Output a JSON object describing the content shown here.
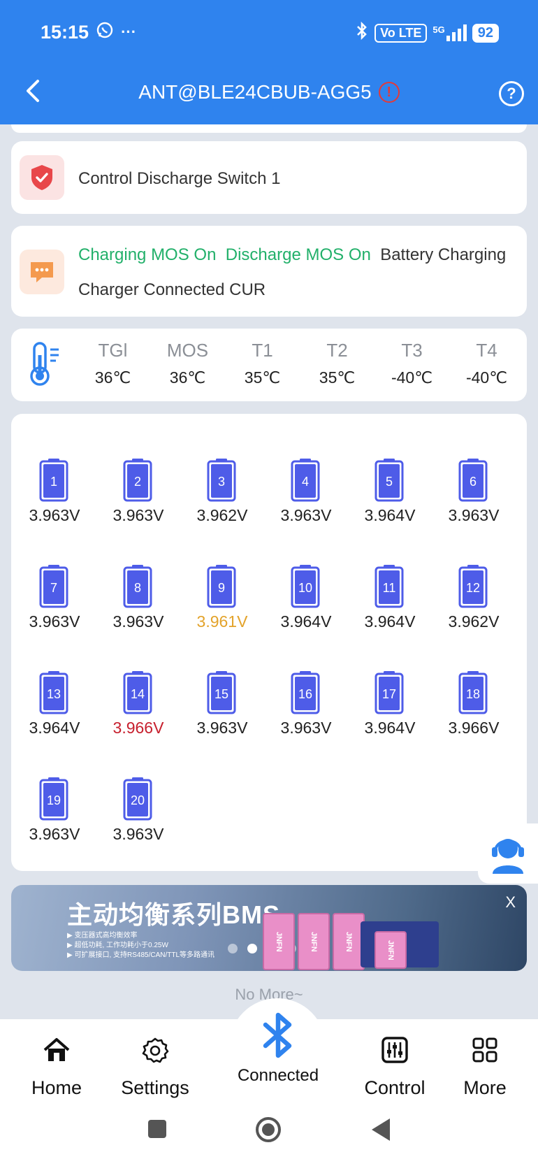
{
  "status_bar": {
    "time": "15:15",
    "volte": "Vo LTE",
    "network": "5G",
    "battery": "92"
  },
  "header": {
    "title": "ANT@BLE24CBUB-AGG5"
  },
  "control_card": {
    "label": "Control Discharge Switch 1"
  },
  "status_card": {
    "charging_mos": "Charging MOS On",
    "discharge_mos": "Discharge MOS On",
    "battery_state": "Battery Charging",
    "line2": "Charger Connected CUR"
  },
  "temps": [
    {
      "name": "TGl",
      "value": "36℃"
    },
    {
      "name": "MOS",
      "value": "36℃"
    },
    {
      "name": "T1",
      "value": "35℃"
    },
    {
      "name": "T2",
      "value": "35℃"
    },
    {
      "name": "T3",
      "value": "-40℃"
    },
    {
      "name": "T4",
      "value": "-40℃"
    }
  ],
  "cells": [
    {
      "n": "1",
      "v": "3.963V"
    },
    {
      "n": "2",
      "v": "3.963V"
    },
    {
      "n": "3",
      "v": "3.962V"
    },
    {
      "n": "4",
      "v": "3.963V"
    },
    {
      "n": "5",
      "v": "3.964V"
    },
    {
      "n": "6",
      "v": "3.963V"
    },
    {
      "n": "7",
      "v": "3.963V"
    },
    {
      "n": "8",
      "v": "3.963V"
    },
    {
      "n": "9",
      "v": "3.961V",
      "state": "min"
    },
    {
      "n": "10",
      "v": "3.964V"
    },
    {
      "n": "11",
      "v": "3.964V"
    },
    {
      "n": "12",
      "v": "3.962V"
    },
    {
      "n": "13",
      "v": "3.964V"
    },
    {
      "n": "14",
      "v": "3.966V",
      "state": "max"
    },
    {
      "n": "15",
      "v": "3.963V"
    },
    {
      "n": "16",
      "v": "3.963V"
    },
    {
      "n": "17",
      "v": "3.964V"
    },
    {
      "n": "18",
      "v": "3.966V"
    },
    {
      "n": "19",
      "v": "3.963V"
    },
    {
      "n": "20",
      "v": "3.963V"
    }
  ],
  "colors": {
    "primary": "#2f83ee",
    "cell": "#4e5ce8",
    "min": "#e3a32b",
    "max": "#c7202e",
    "ok": "#22b06a"
  },
  "banner": {
    "title": "主动均衡系列BMS",
    "bullets": [
      "▶ 变压器式高均衡效率",
      "▶ 超低功耗, 工作功耗小于0.25W",
      "▶ 可扩展接口, 支持RS485/CAN/TTL等多路通讯"
    ],
    "brand": "JNFN",
    "close": "X"
  },
  "no_more": "No More~",
  "nav": {
    "home": "Home",
    "settings": "Settings",
    "connected": "Connected",
    "control": "Control",
    "more": "More"
  }
}
